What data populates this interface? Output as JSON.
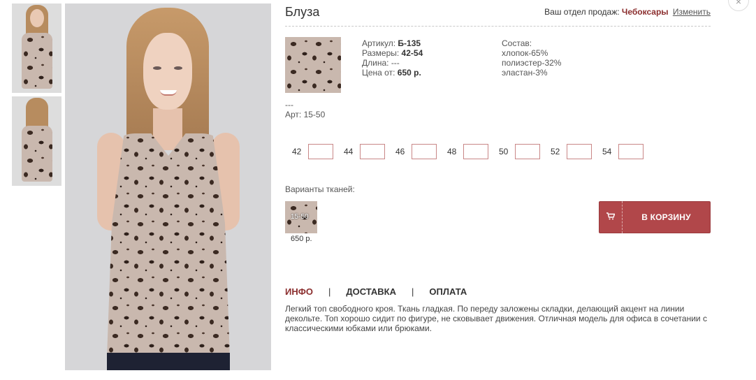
{
  "product": {
    "title": "Блуза",
    "article_label": "Артикул:",
    "article_value": "Б-135",
    "sizes_label": "Размеры:",
    "sizes_value": "42-54",
    "length_label": "Длина:",
    "length_value": "---",
    "price_label": "Цена от:",
    "price_value": "650 р.",
    "composition_label": "Состав:",
    "composition": [
      "хлопок-65%",
      "полиэстер-32%",
      "эластан-3%"
    ],
    "dashes": "---",
    "art_line": "Арт: 15-50"
  },
  "department": {
    "label": "Ваш отдел продаж:",
    "city": "Чебоксары",
    "change_link": "Изменить"
  },
  "size_grid": [
    "42",
    "44",
    "46",
    "48",
    "50",
    "52",
    "54"
  ],
  "variants": {
    "label": "Варианты тканей:",
    "items": [
      {
        "code": "15-50",
        "price": "650 р."
      }
    ]
  },
  "cart_button": {
    "label": "В КОРЗИНУ",
    "icon": "cart-icon"
  },
  "tabs": [
    {
      "label": "ИНФО",
      "active": true
    },
    {
      "label": "ДОСТАВКА",
      "active": false
    },
    {
      "label": "ОПЛАТА",
      "active": false
    }
  ],
  "tab_separator": "|",
  "description": "Легкий топ свободного кроя. Ткань гладкая. По переду заложены складки, делающий акцент на линии декольте. Топ хорошо сидит по фигуре, не сковывает движения. Отличная модель для офиса в сочетании с классическими юбками или брюками.",
  "close_icon": "×",
  "colors": {
    "accent": "#b1474a",
    "link_dark": "#8b2e2e"
  }
}
